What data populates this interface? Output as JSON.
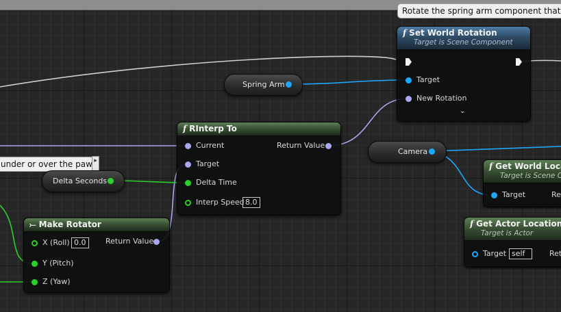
{
  "comments": [
    {
      "text": "Rotate the spring arm component that pos"
    },
    {
      "text": "under or over the pawn"
    }
  ],
  "nodes": {
    "set_world_rotation": {
      "title": "Set World Rotation",
      "subtitle": "Target is Scene Component",
      "pins": {
        "target": "Target",
        "new_rotation": "New Rotation"
      }
    },
    "rinterp_to": {
      "title": "RInterp To",
      "pins": {
        "current": "Current",
        "target": "Target",
        "delta_time": "Delta Time",
        "interp_speed": "Interp Speed",
        "return_value": "Return Value"
      },
      "interp_speed_value": "8.0"
    },
    "make_rotator": {
      "title": "Make Rotator",
      "pins": {
        "x_roll": "X (Roll)",
        "y_pitch": "Y (Pitch)",
        "z_yaw": "Z (Yaw)",
        "return_value": "Return Value"
      },
      "x_roll_value": "0.0"
    },
    "get_world_location": {
      "title": "Get World Location",
      "subtitle": "Target is Scene Component",
      "pins": {
        "target": "Target",
        "return_value": "Return Value"
      }
    },
    "get_actor_location": {
      "title": "Get Actor Location",
      "subtitle": "Target is Actor",
      "pins": {
        "target": "Target",
        "return_value": "Return Value"
      },
      "target_value": "self"
    }
  },
  "variables": {
    "spring_arm": "Spring Arm",
    "delta_seconds": "Delta Seconds",
    "camera": "Camera"
  },
  "icons": {
    "function": "f",
    "expand": "⌄",
    "make_struct": "⤚"
  },
  "colors": {
    "object_pin": "#1ea7ff",
    "rotator_pin": "#a8a8f0",
    "float_pin": "#2ad22a",
    "exec_pin": "#f2f2f2",
    "function_header_blue": "#4e7da6",
    "pure_header_green": "#5d8055"
  }
}
